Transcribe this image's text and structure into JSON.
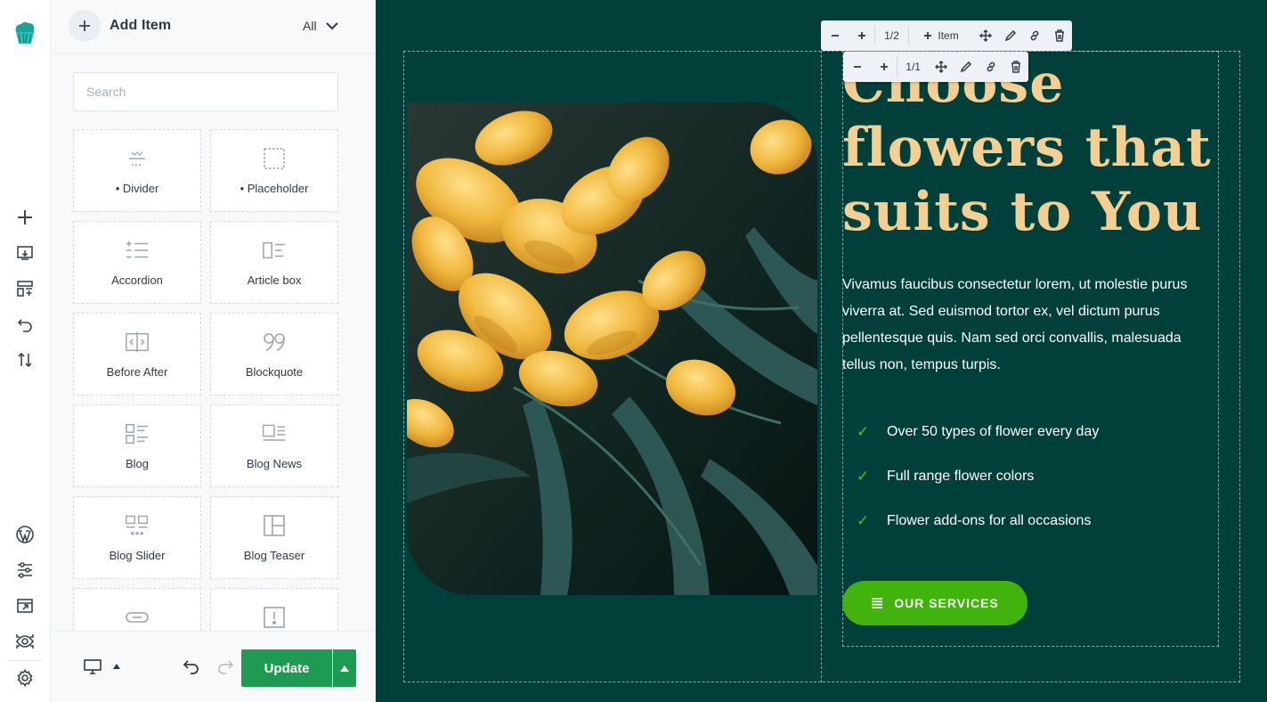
{
  "panel": {
    "title": "Add Item",
    "filter": "All",
    "search_placeholder": "Search",
    "tiles": [
      {
        "label": "• Divider",
        "icon": "divider-icon"
      },
      {
        "label": "• Placeholder",
        "icon": "placeholder-icon"
      },
      {
        "label": "Accordion",
        "icon": "accordion-icon"
      },
      {
        "label": "Article box",
        "icon": "article-box-icon"
      },
      {
        "label": "Before After",
        "icon": "before-after-icon"
      },
      {
        "label": "Blockquote",
        "icon": "blockquote-icon"
      },
      {
        "label": "Blog",
        "icon": "blog-icon"
      },
      {
        "label": "Blog News",
        "icon": "blog-news-icon"
      },
      {
        "label": "Blog Slider",
        "icon": "blog-slider-icon"
      },
      {
        "label": "Blog Teaser",
        "icon": "blog-teaser-icon"
      },
      {
        "label": "",
        "icon": "button-icon"
      },
      {
        "label": "",
        "icon": "alert-icon"
      }
    ],
    "update_label": "Update"
  },
  "toolbar_outer": {
    "counter": "1/2",
    "item_label": "Item"
  },
  "toolbar_inner": {
    "counter": "1/1"
  },
  "content": {
    "heading": "Choose flowers that suits to You",
    "paragraph": "Vivamus faucibus consectetur lorem, ut molestie purus viverra at. Sed euismod tortor ex, vel dictum purus pellentesque quis. Nam sed orci convallis, malesuada tellus non, tempus turpis.",
    "features": [
      "Over 50 types of flower every day",
      "Full range flower colors",
      "Flower add-ons for all occasions"
    ],
    "cta_label": "OUR SERVICES"
  },
  "colors": {
    "canvas_bg": "#003f3a",
    "heading": "#f3cf94",
    "accent_green": "#41b30c",
    "update_green": "#1f9a52"
  }
}
